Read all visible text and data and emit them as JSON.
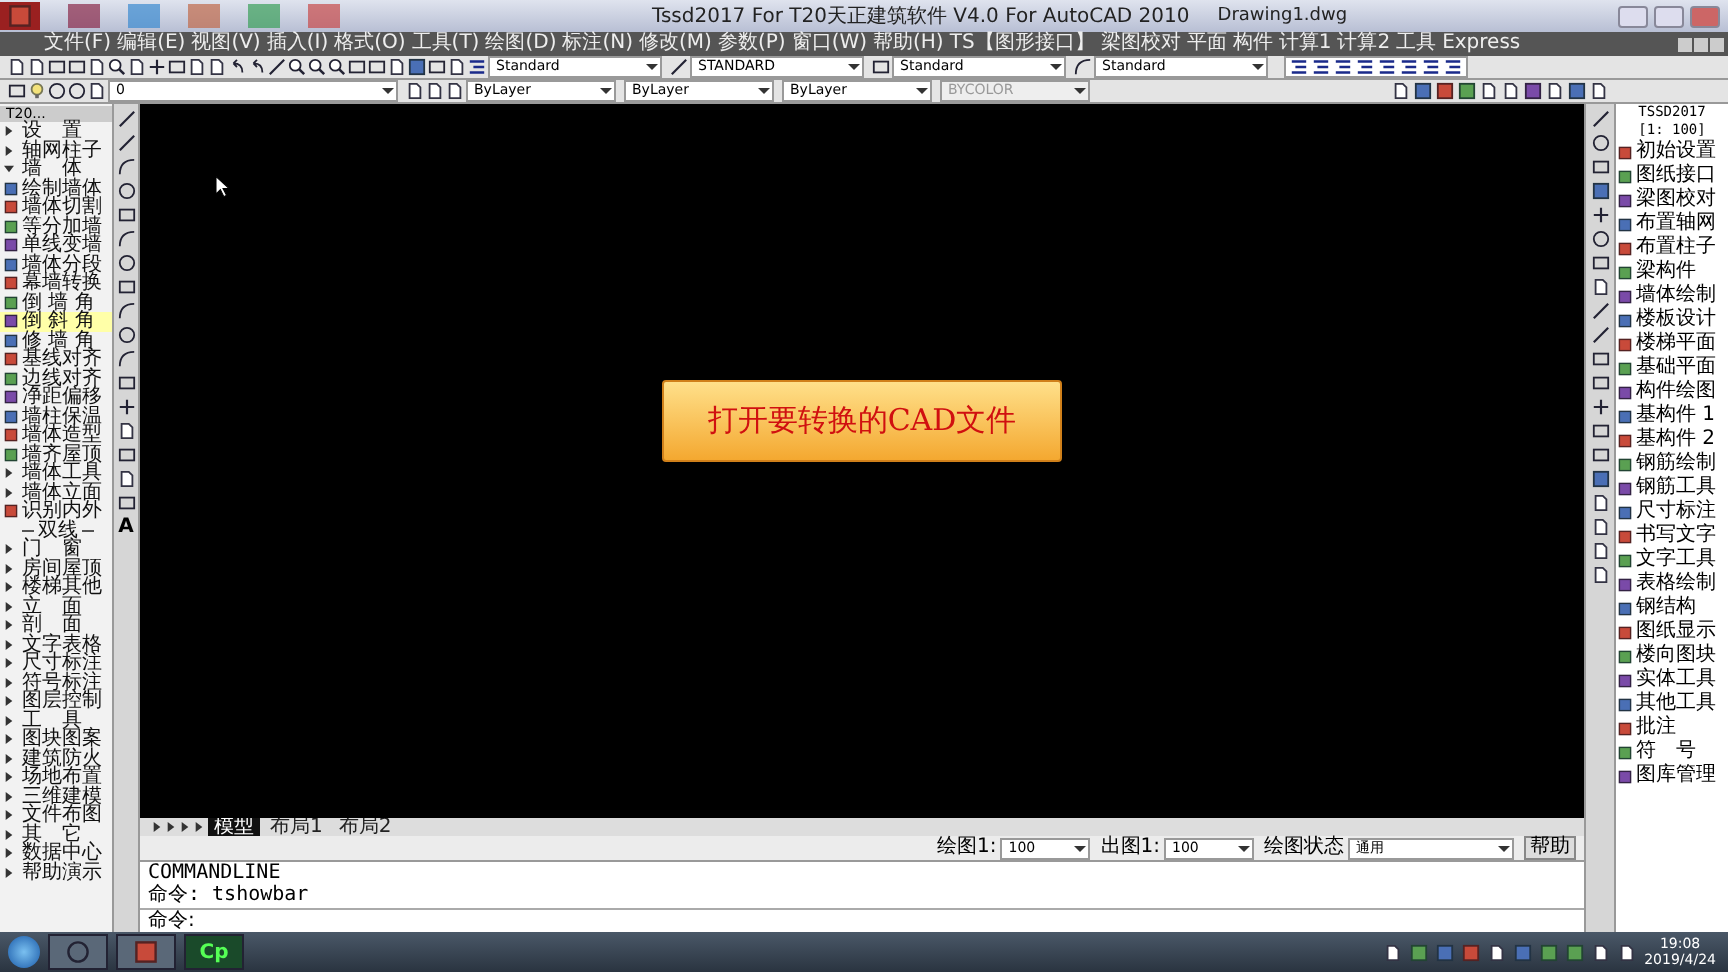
{
  "window": {
    "title": "Tssd2017 For T20天正建筑软件 V4.0 For AutoCAD 2010",
    "document": "Drawing1.dwg"
  },
  "menu": [
    "文件(F)",
    "编辑(E)",
    "视图(V)",
    "插入(I)",
    "格式(O)",
    "工具(T)",
    "绘图(D)",
    "标注(N)",
    "修改(M)",
    "参数(P)",
    "窗口(W)",
    "帮助(H)",
    "TS【图形接口】",
    "梁图校对",
    "平面",
    "构件",
    "计算1",
    "计算2",
    "工具",
    "Express"
  ],
  "styles_toolbar": {
    "text_style": "Standard",
    "dim_style": "STANDARD",
    "table_style": "Standard",
    "multileader_style": "Standard"
  },
  "layers_toolbar": {
    "layer": "0",
    "color_control": "ByLayer",
    "linetype": "ByLayer",
    "lineweight": "ByLayer",
    "plot_style": {
      "value": "BYCOLOR",
      "disabled": true
    }
  },
  "sidebar": {
    "title": "T20...",
    "items": [
      {
        "kind": "group",
        "label": "设　置",
        "expanded": false
      },
      {
        "kind": "group",
        "label": "轴网柱子",
        "expanded": false
      },
      {
        "kind": "group",
        "label": "墙　体",
        "expanded": true,
        "children": [
          {
            "kind": "tool",
            "label": "绘制墙体",
            "selected": false
          },
          {
            "kind": "tool",
            "label": "墙体切割",
            "selected": false
          },
          {
            "kind": "tool",
            "label": "等分加墙",
            "selected": false
          },
          {
            "kind": "tool",
            "label": "单线变墙",
            "selected": false
          },
          {
            "kind": "tool",
            "label": "墙体分段",
            "selected": false
          },
          {
            "kind": "tool",
            "label": "幕墙转换",
            "selected": false
          },
          {
            "kind": "tool",
            "label": "倒 墙 角",
            "selected": false
          },
          {
            "kind": "tool",
            "label": "倒 斜 角",
            "selected": true
          },
          {
            "kind": "tool",
            "label": "修 墙 角",
            "selected": false
          },
          {
            "kind": "tool",
            "label": "基线对齐",
            "selected": false
          },
          {
            "kind": "tool",
            "label": "边线对齐",
            "selected": false
          },
          {
            "kind": "tool",
            "label": "净距偏移",
            "selected": false
          },
          {
            "kind": "tool",
            "label": "墙柱保温",
            "selected": false
          },
          {
            "kind": "tool",
            "label": "墙体造型",
            "selected": false
          },
          {
            "kind": "tool",
            "label": "墙齐屋顶",
            "selected": false
          },
          {
            "kind": "group",
            "label": "墙体工具",
            "expanded": false
          },
          {
            "kind": "group",
            "label": "墙体立面",
            "expanded": false
          },
          {
            "kind": "tool",
            "label": "识别内外",
            "selected": false
          }
        ]
      },
      {
        "kind": "section",
        "label": "双线"
      },
      {
        "kind": "group",
        "label": "门　窗",
        "expanded": false
      },
      {
        "kind": "group",
        "label": "房间屋顶",
        "expanded": false
      },
      {
        "kind": "group",
        "label": "楼梯其他",
        "expanded": false
      },
      {
        "kind": "group",
        "label": "立　面",
        "expanded": false
      },
      {
        "kind": "group",
        "label": "剖　面",
        "expanded": false
      },
      {
        "kind": "group",
        "label": "文字表格",
        "expanded": false
      },
      {
        "kind": "group",
        "label": "尺寸标注",
        "expanded": false
      },
      {
        "kind": "group",
        "label": "符号标注",
        "expanded": false
      },
      {
        "kind": "group",
        "label": "图层控制",
        "expanded": false
      },
      {
        "kind": "group",
        "label": "工　具",
        "expanded": false
      },
      {
        "kind": "group",
        "label": "图块图案",
        "expanded": false
      },
      {
        "kind": "group",
        "label": "建筑防火",
        "expanded": false
      },
      {
        "kind": "group",
        "label": "场地布置",
        "expanded": false
      },
      {
        "kind": "group",
        "label": "三维建模",
        "expanded": false
      },
      {
        "kind": "group",
        "label": "文件布图",
        "expanded": false
      },
      {
        "kind": "group",
        "label": "其　它",
        "expanded": false
      },
      {
        "kind": "group",
        "label": "数据中心",
        "expanded": false
      },
      {
        "kind": "group",
        "label": "帮助演示",
        "expanded": false
      }
    ]
  },
  "draw_toolbar": {
    "text_tool": "A"
  },
  "canvas": {
    "banner": "打开要转换的CAD文件"
  },
  "layout_tabs": [
    {
      "label": "模型",
      "selected": true
    },
    {
      "label": "布局1",
      "selected": false
    },
    {
      "label": "布局2",
      "selected": false
    }
  ],
  "status_bar": {
    "draw_scale_label": "绘图1:",
    "draw_scale": "100",
    "plot_scale_label": "出图1:",
    "plot_scale": "100",
    "state_label": "绘图状态",
    "state": "通用",
    "help": "帮助"
  },
  "command_line": {
    "history": [
      "COMMANDLINE",
      "命令: tshowbar"
    ],
    "prompt": "命令:"
  },
  "right_panel": {
    "title": "TSSD2017",
    "scale": "[1: 100]",
    "items": [
      "初始设置",
      "图纸接口",
      "梁图校对",
      "布置轴网",
      "布置柱子",
      "梁构件",
      "墙体绘制",
      "楼板设计",
      "楼梯平面",
      "基础平面",
      "构件绘图",
      "基构件 1",
      "基构件 2",
      "钢筋绘制",
      "钢筋工具",
      "尺寸标注",
      "书写文字",
      "文字工具",
      "表格绘制",
      "钢结构",
      "图纸显示",
      "楼向图块",
      "实体工具",
      "其他工具",
      "批注",
      "符　号",
      "图库管理"
    ]
  },
  "taskbar": {
    "app_label": "Cp",
    "time": "19:08",
    "date": "2019/4/24"
  }
}
